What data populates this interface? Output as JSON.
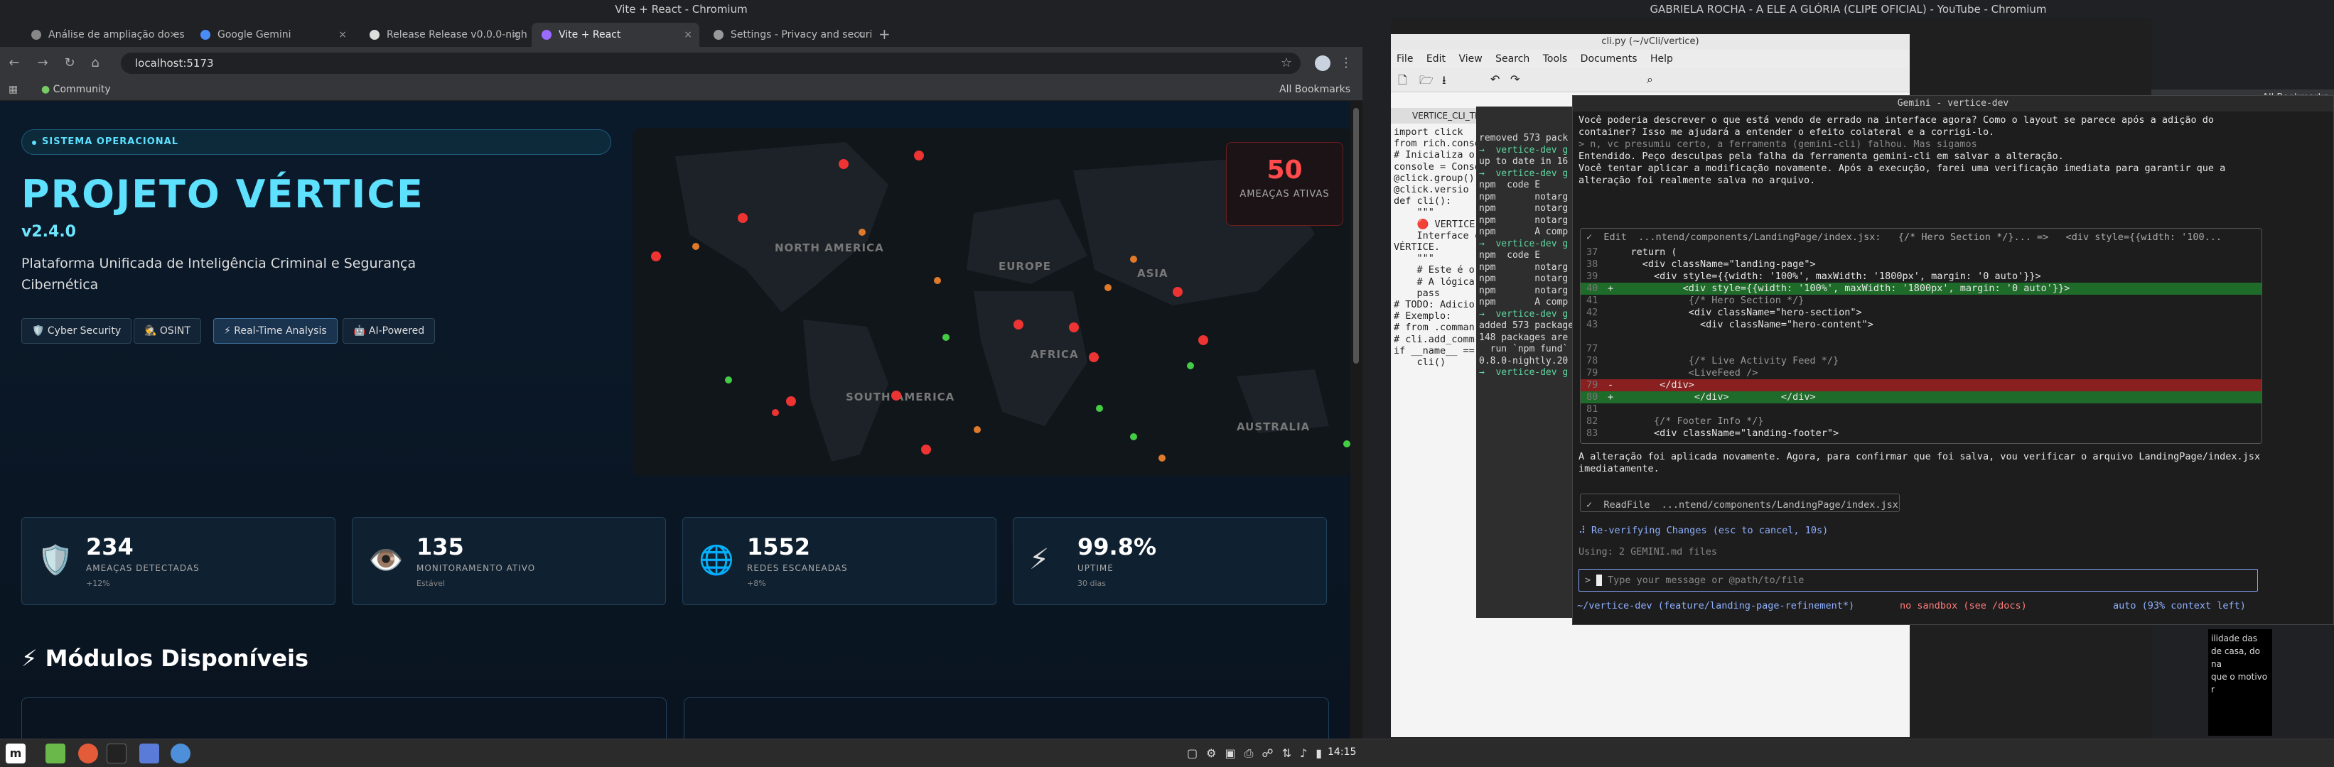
{
  "left": {
    "window_title": "Vite + React - Chromium",
    "tabs": [
      "Análise de ampliação do es...",
      "Google Gemini",
      "Release Release v0.0.0-nigh...",
      "Vite + React",
      "Settings - Privacy and securit..."
    ],
    "url": "localhost:5173",
    "bookmark": "Community",
    "all_bookmarks": "All Bookmarks",
    "status_badge": "SISTEMA OPERACIONAL",
    "title": "PROJETO VÉRTICE",
    "version": "v2.4.0",
    "description": "Plataforma Unificada de Inteligência Criminal e Segurança Cibernética",
    "chips": [
      "🛡️ Cyber Security",
      "🕵️ OSINT",
      "⚡ Real-Time Analysis",
      "🤖 AI-Powered"
    ],
    "map_labels": [
      "NORTH AMERICA",
      "EUROPE",
      "ASIA",
      "AFRICA",
      "SOUTH AMERICA",
      "AUSTRALIA"
    ],
    "threats": {
      "value": "50",
      "label": "AMEAÇAS ATIVAS"
    },
    "stats": [
      {
        "icon": "🛡️",
        "value": "234",
        "label": "AMEAÇAS DETECTADAS",
        "sub": "+12%"
      },
      {
        "icon": "👁️",
        "value": "135",
        "label": "MONITORAMENTO ATIVO",
        "sub": "Estável"
      },
      {
        "icon": "🌐",
        "value": "1552",
        "label": "REDES ESCANEADAS",
        "sub": "+8%"
      },
      {
        "icon": "⚡",
        "value": "99.8%",
        "label": "UPTIME",
        "sub": "30 dias"
      }
    ],
    "modules_title": "⚡ Módulos Disponíveis"
  },
  "right": {
    "window_title": "GABRIELA ROCHA - A ELE A GLÓRIA (CLIPE OFICIAL) - YouTube - Chromium",
    "editor_title": "cli.py (~/vCli/vertice)",
    "editor_menu": [
      "File",
      "Edit",
      "View",
      "Search",
      "Tools",
      "Documents",
      "Help"
    ],
    "editor_tab": "VERTICE_CLI_TERMINAL_BLUEPRINT",
    "editor_code": [
      "import click",
      "from rich.console import Console",
      "",
      "# Inicializa o",
      "console = Conso",
      "",
      "@click.group()",
      "@click.versio",
      "def cli():",
      "    \"\"\"",
      "    🔴 VERTICE",
      "",
      "    Interface c",
      "VÉRTICE.",
      "    \"\"\"",
      "    # Este é o",
      "    # A lógica",
      "    pass",
      "",
      "# TODO: Adicio",
      "# Exemplo:",
      "# from .comman",
      "# cli.add_comm",
      "",
      "if __name__ ==",
      "    cli()"
    ],
    "term_lines": [
      "removed 573 pack",
      "→  vertice-dev g",
      "",
      "up to date in 16",
      "→  vertice-dev g",
      "npm  code E",
      "npm       notarg",
      "npm       notarg",
      "npm       notarg",
      "npm       A comp",
      "→  vertice-dev g",
      "npm  code E",
      "npm       notarg",
      "npm       notarg",
      "npm       notarg",
      "npm       A comp",
      "→  vertice-dev g",
      "",
      "added 573 package",
      "",
      "148 packages are",
      "  run `npm fund`",
      "0.8.0-nightly.20",
      "→  vertice-dev g"
    ],
    "gemini_title": "Gemini - vertice-dev",
    "gemini_lines": [
      "Você poderia descrever o que está vendo de errado na interface agora? Como o layout se parece após a adição do",
      "container? Isso me ajudará a entender o efeito colateral e a corrigi-lo.",
      "",
      "> n, vc presumiu certo, a ferramenta (gemini-cli) falhou. Mas sigamos",
      "",
      "Entendido. Peço desculpas pela falha da ferramenta gemini-cli em salvar a alteração.",
      "",
      "Você tentar aplicar a modificação novamente. Após a execução, farei uma verificação imediata para garantir que a",
      "alteração foi realmente salva no arquivo."
    ],
    "edit_header": "✓  Edit  ...ntend/components/LandingPage/index.jsx:   {/* Hero Section */}... =>   <div style={{width: '100...",
    "diff": [
      {
        "n": "37",
        "t": "    return (",
        "k": ""
      },
      {
        "n": "38",
        "t": "      <div className=\"landing-page\">",
        "k": ""
      },
      {
        "n": "39",
        "t": "        <div style={{width: '100%', maxWidth: '1800px', margin: '0 auto'}}>",
        "k": ""
      },
      {
        "n": "40",
        "t": "+            <div style={{width: '100%', maxWidth: '1800px', margin: '0 auto'}}>",
        "k": "add"
      },
      {
        "n": "41",
        "t": "              {/* Hero Section */}",
        "k": "c"
      },
      {
        "n": "42",
        "t": "              <div className=\"hero-section\">",
        "k": ""
      },
      {
        "n": "43",
        "t": "                <div className=\"hero-content\">",
        "k": ""
      },
      {
        "n": "",
        "t": "",
        "k": ""
      },
      {
        "n": "77",
        "t": "",
        "k": ""
      },
      {
        "n": "78",
        "t": "              {/* Live Activity Feed */}",
        "k": "c"
      },
      {
        "n": "79",
        "t": "              <LiveFeed />",
        "k": "c"
      },
      {
        "n": "79",
        "t": "-        </div>",
        "k": "del"
      },
      {
        "n": "80",
        "t": "+              </div>         </div>",
        "k": "add"
      },
      {
        "n": "81",
        "t": "",
        "k": ""
      },
      {
        "n": "82",
        "t": "        {/* Footer Info */}",
        "k": "c"
      },
      {
        "n": "83",
        "t": "        <div className=\"landing-footer\">",
        "k": ""
      }
    ],
    "after_edit": [
      "A alteração foi aplicada novamente. Agora, para confirmar que foi salva, vou verificar o arquivo LandingPage/index.jsx",
      "imediatamente."
    ],
    "readfile": "✓  ReadFile  ...ntend/components/LandingPage/index.jsx",
    "reverify": "⠼ Re-verifying Changes (esc to cancel, 10s)",
    "using": "Using: 2 GEMINI.md files",
    "placeholder": "Type your message or @path/to/file",
    "footer_left": "~/vertice-dev (feature/landing-page-refinement*)",
    "footer_mid": "no sandbox (see /docs)",
    "footer_right": "auto (93% context left)",
    "yt_snip": [
      "ilidade das",
      "de casa, do na",
      "que o motivo r"
    ]
  },
  "clock": "14:15",
  "colors": {
    "accent": "#5ee0ff",
    "threat": "#ff4b4b",
    "diff_add": "#1f6b2a",
    "diff_del": "#8a1f1f"
  }
}
